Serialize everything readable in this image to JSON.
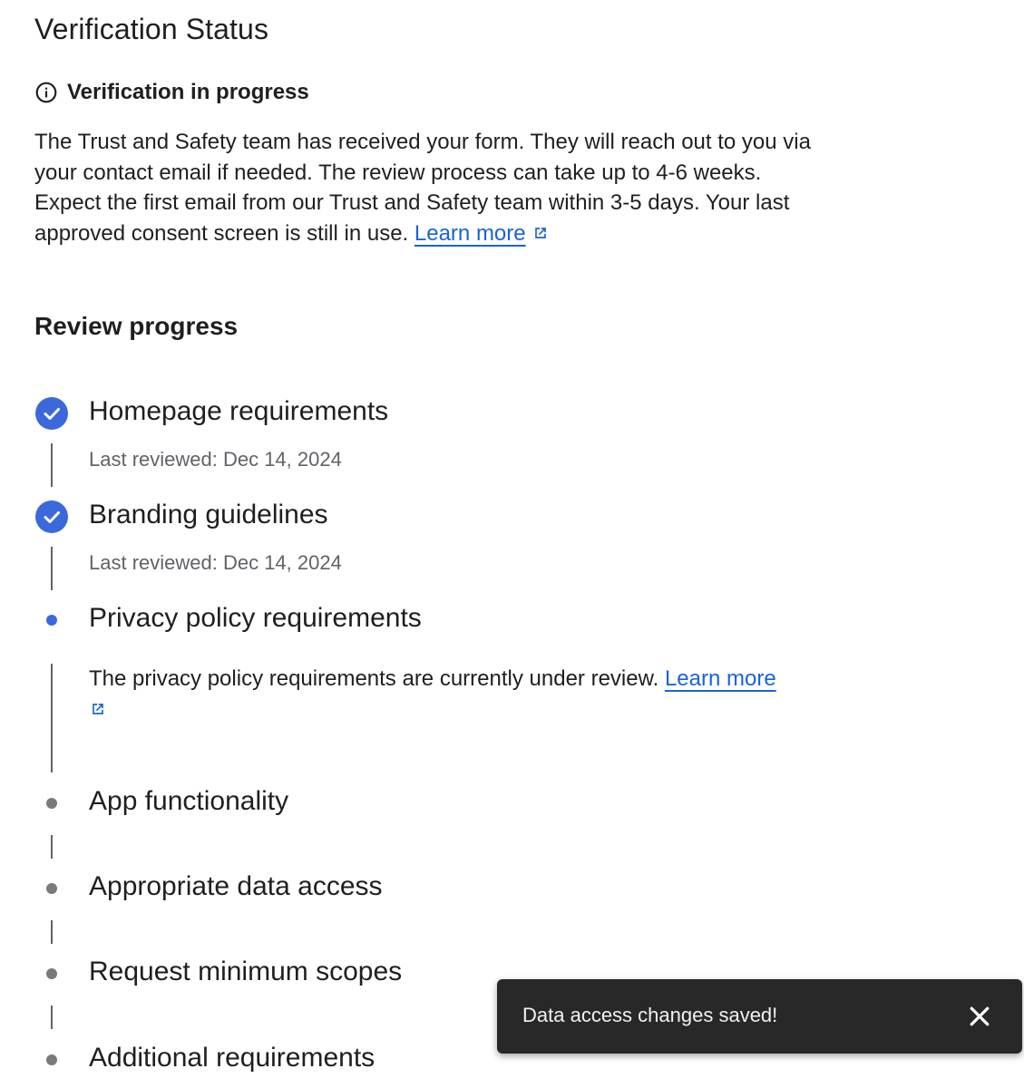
{
  "page": {
    "title": "Verification Status"
  },
  "status": {
    "heading": "Verification in progress",
    "description": "The Trust and Safety team has received your form. They will reach out to you via your contact email if needed. The review process can take up to 4-6 weeks. Expect the first email from our Trust and Safety team within 3-5 days. Your last approved consent screen is still in use. ",
    "link_label": "Learn more",
    "info_icon": "info-icon",
    "external_icon": "open-in-new-icon"
  },
  "review": {
    "title": "Review progress",
    "steps": [
      {
        "label": "Homepage requirements",
        "state": "complete",
        "sub": "Last reviewed: Dec 14, 2024"
      },
      {
        "label": "Branding guidelines",
        "state": "complete",
        "sub": "Last reviewed: Dec 14, 2024"
      },
      {
        "label": "Privacy policy requirements",
        "state": "in-progress",
        "sub": "The privacy policy requirements are currently under review. ",
        "link_label": "Learn more"
      },
      {
        "label": "App functionality",
        "state": "pending"
      },
      {
        "label": "Appropriate data access",
        "state": "pending"
      },
      {
        "label": "Request minimum scopes",
        "state": "pending"
      },
      {
        "label": "Additional requirements",
        "state": "pending"
      }
    ]
  },
  "toast": {
    "message": "Data access changes saved!",
    "close_icon": "close-icon"
  },
  "colors": {
    "accent": "#3b69dc",
    "link": "#1a64d3",
    "pending_dot": "#7a7a7a",
    "toast_bg": "#282828"
  }
}
